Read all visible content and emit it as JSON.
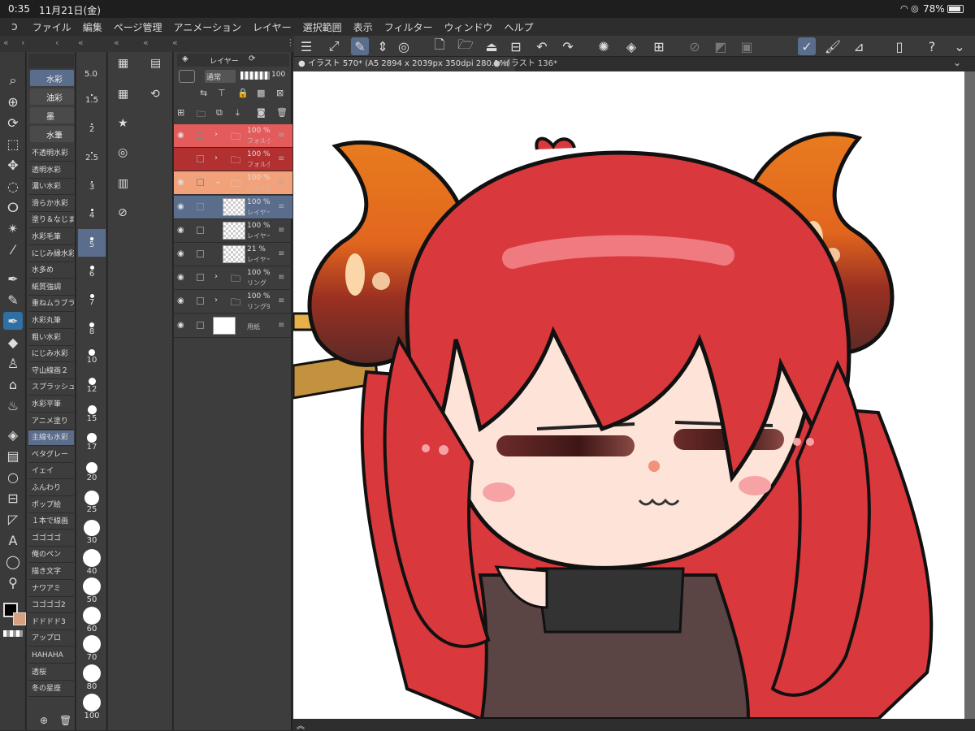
{
  "status": {
    "time": "0:35",
    "date": "11月21日(金)",
    "battery": "78%"
  },
  "menu": [
    "ファイル",
    "編集",
    "ページ管理",
    "アニメーション",
    "レイヤー",
    "選択範囲",
    "表示",
    "フィルター",
    "ウィンドウ",
    "ヘルプ"
  ],
  "doc_tabs": {
    "active": "イラスト 570* (A5 2894 x 2039px 350dpi 280.1%)",
    "inactive": "イラスト 136*"
  },
  "brush_tabs": [
    "水彩",
    "油彩",
    "墨",
    "水筆"
  ],
  "brushes": [
    "不透明水彩",
    "透明水彩",
    "濃い水彩",
    "滑らか水彩",
    "塗り＆なじませ",
    "水彩毛筆",
    "にじみ縁水彩",
    "水多め",
    "紙質強調",
    "重ねムラブラシ",
    "水彩丸筆",
    "粗い水彩",
    "にじみ水彩",
    "守山線画２",
    "スプラッシュ",
    "水彩平筆",
    "アニメ塗り",
    "主線も水彩",
    "ベタグレー",
    "イェイ",
    "ふんわり",
    "ポップ絵",
    "１本で線画",
    "ゴゴゴゴ",
    "俺のペン",
    "描き文字",
    "ナワアミ",
    "コゴゴゴ2",
    "ドドドド3",
    "アップロ",
    "HAHAHA",
    "透桜",
    "冬の星座"
  ],
  "brush_size_current": "5.0",
  "sizes": [
    "1.5",
    "2",
    "2.5",
    "3",
    "4",
    "5",
    "6",
    "7",
    "8",
    "10",
    "12",
    "15",
    "17",
    "20",
    "25",
    "30",
    "40",
    "50",
    "60",
    "70",
    "80",
    "100"
  ],
  "layer_panel": {
    "tab": "レイヤー",
    "blend": "通常",
    "opacity": "100"
  },
  "layers": [
    {
      "pct": "100 %",
      "name": "フォルダ"
    },
    {
      "pct": "100 %",
      "name": "フォルダ"
    },
    {
      "pct": "100 %",
      "name": "フォルダ"
    },
    {
      "pct": "100 %",
      "name": "レイヤー"
    },
    {
      "pct": "100 %",
      "name": "レイヤー"
    },
    {
      "pct": "21 %",
      "name": "レイヤー"
    },
    {
      "pct": "100 %",
      "name": "リング"
    },
    {
      "pct": "100 %",
      "name": "リング9"
    },
    {
      "pct": "",
      "name": "用紙"
    }
  ],
  "colors": {
    "hair": "#d9383c",
    "horn_top": "#e87b1f",
    "horn_bottom": "#5c2a26",
    "skin": "#fde3d8",
    "sweater": "#4a3b3b",
    "accent": "#5b6d8c"
  }
}
